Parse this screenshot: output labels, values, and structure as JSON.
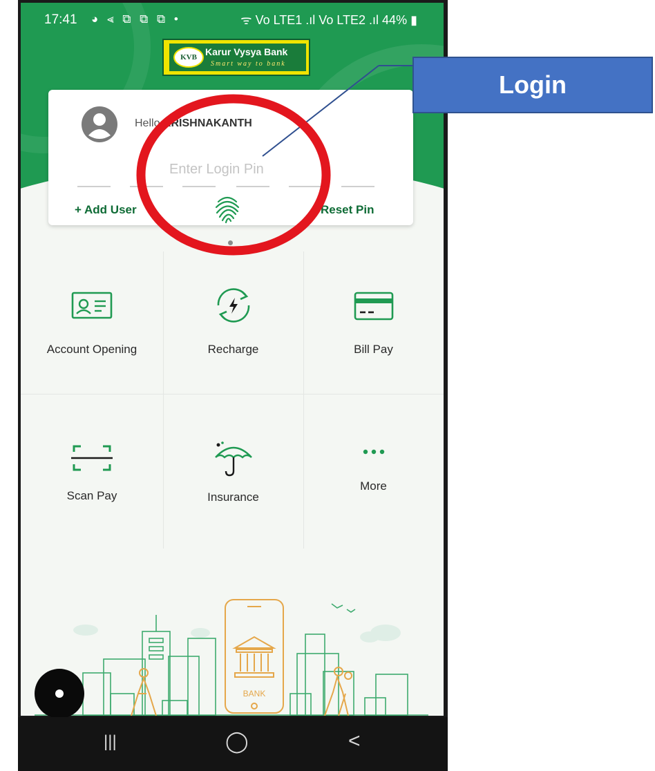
{
  "status_bar": {
    "time": "17:41",
    "notification_icons": "◕ ⪡ ⧉ ⧉ ⧉ •",
    "signal_text": "ᯤ Vo LTE1 .ıl Vo LTE2 .ıl",
    "battery": "44%"
  },
  "brand": {
    "badge": "KVB",
    "name": "Karur Vysya Bank",
    "tagline": "Smart way to bank",
    "primary_color": "#1f9a52"
  },
  "login": {
    "greeting": "Hello",
    "user_name": "KRISHNAKANTH",
    "pin_placeholder": "Enter Login Pin",
    "add_user": "+ Add User",
    "reset_pin": "Reset Pin",
    "biometric_icon": "fingerprint-icon"
  },
  "services": [
    {
      "label": "Account Opening",
      "icon": "id-card-icon"
    },
    {
      "label": "Recharge",
      "icon": "recharge-icon"
    },
    {
      "label": "Bill Pay",
      "icon": "card-icon"
    },
    {
      "label": "Scan Pay",
      "icon": "scan-icon"
    },
    {
      "label": "Insurance",
      "icon": "umbrella-icon"
    },
    {
      "label": "More",
      "icon": "more-icon"
    }
  ],
  "illustration": {
    "phone_label": "BANK"
  },
  "navigation": {
    "recents": "|||",
    "home": "◯",
    "back": "<"
  },
  "annotation": {
    "label": "Login",
    "highlight_color": "#e3161e",
    "box_color": "#4472c4"
  }
}
